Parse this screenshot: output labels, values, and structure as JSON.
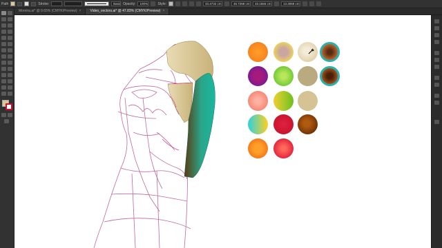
{
  "control_bar": {
    "panel_label": "Path",
    "stroke_label": "Stroke:",
    "stroke_profile": "Basic",
    "opacity_label": "Opacity:",
    "opacity_value": "100%",
    "style_label": "Style:",
    "x_value": "33.4732 cm",
    "y_value": "46.7268 cm",
    "w_value": "33.1556 cm",
    "h_value": "13.3069 cm"
  },
  "tabs": [
    {
      "label": "Moreira.ai* @ 9.65% (CMYK/Preview)",
      "close": "×"
    },
    {
      "label": "Video_vectors.ai* @ 47.83% (CMYK/Preview)",
      "close": "×"
    }
  ],
  "colors": {
    "fill": "#d8c89a",
    "accent_teal": "#18b8a0"
  },
  "swatches": [
    {
      "fill": "radial-gradient(circle at 50% 50%, #ff9e2a, #f27a18)",
      "ring": false
    },
    {
      "fill": "radial-gradient(circle at 50% 50%, #caa6a0 30%, #f0d75a 75%)",
      "ring": false
    },
    {
      "fill": "radial-gradient(circle at 45% 45%, #f4ecd8 20%, #d8c89a 90%)",
      "ring": false
    },
    {
      "fill": "radial-gradient(circle at 50% 50%, #5a2a10 20%, #c06a30 75%)",
      "ring": true
    },
    {
      "fill": "radial-gradient(circle at 50% 50%, #a61a7c 30%, #6a1aa0 90%)",
      "ring": false
    },
    {
      "fill": "radial-gradient(circle at 50% 50%, #b9e65a 20%, #5ac02a 90%)",
      "ring": false
    },
    {
      "fill": "#b9ab7f",
      "ring": false
    },
    {
      "fill": "radial-gradient(circle at 50% 50%, #4a2008 25%, #a0521e 70%)",
      "ring": true
    },
    {
      "fill": "radial-gradient(circle at 50% 50%, #ffb0a0 20%, #f07a6a 90%)",
      "ring": false
    },
    {
      "fill": "linear-gradient(90deg, #f0d030, #6cc020)",
      "ring": false
    },
    {
      "fill": "#d6c394",
      "ring": false
    },
    {
      "fill": "linear-gradient(90deg, #2ed0e0, #ffd020)",
      "ring": false
    },
    {
      "fill": "radial-gradient(circle at 50% 50%, #e02040, #c0102a)",
      "ring": false
    },
    {
      "fill": "radial-gradient(circle at 45% 45%, #b05a10 20%, #5a2400 90%)",
      "ring": false
    },
    {
      "fill": "radial-gradient(circle at 50% 50%, #ff9e2a 30%, #ee6a10 90%)",
      "ring": false
    },
    {
      "fill": "radial-gradient(circle at 50% 50%, #ff6a5a 15%, #e01a3a 80%)",
      "ring": false
    }
  ]
}
